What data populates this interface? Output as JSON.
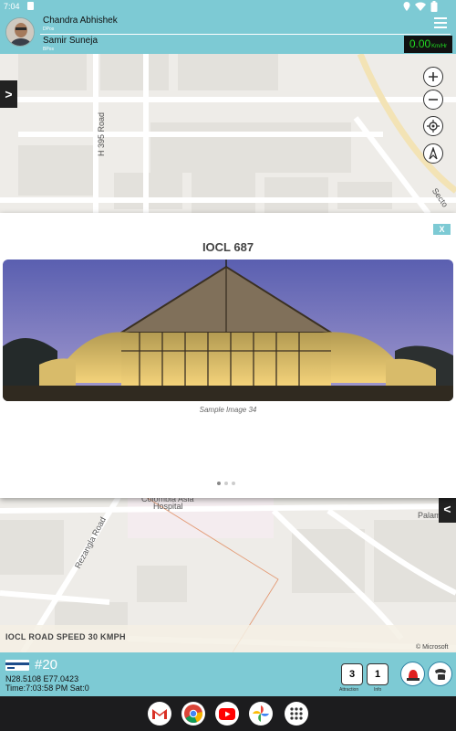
{
  "status": {
    "time": "7:04"
  },
  "header": {
    "driver_name": "Chandra  Abhishek",
    "driver_role": "DPos",
    "second_name": "Samir  Suneja",
    "second_role": "BPos",
    "speed": "0.00",
    "speed_unit": "Km/Hr"
  },
  "map": {
    "road_labels": [
      "H 395 Road",
      "Secto",
      "Rezangla Road",
      "Palama",
      "Colombia Asia",
      "Hospital"
    ],
    "speed_notice": "IOCL ROAD SPEED 30 KMPH",
    "copyright": "© Microsoft",
    "side_left_label": ">",
    "side_right_label": "<"
  },
  "popup": {
    "close_label": "X",
    "title": "IOCL 687",
    "caption": "Sample Image 34",
    "page_count": 3,
    "active_page": 1
  },
  "bottom": {
    "vehicle_id": "#20",
    "coords": "N28.5108 E77.0423",
    "time_line": "Time:7:03:58 PM Sat:0",
    "attraction_count": "3",
    "attraction_label": "Attraction",
    "info_count": "1",
    "info_label": "Info"
  },
  "colors": {
    "accent": "#7dcad4",
    "speed_green": "#22dd22"
  },
  "icons": [
    "location-icon",
    "wifi-icon",
    "battery-icon",
    "menu-icon",
    "zoom-in-icon",
    "zoom-out-icon",
    "locate-icon",
    "compass-icon",
    "alarm-icon",
    "sos-icon",
    "card-icon",
    "gmail-icon",
    "chrome-icon",
    "youtube-icon",
    "photos-icon",
    "apps-icon"
  ]
}
